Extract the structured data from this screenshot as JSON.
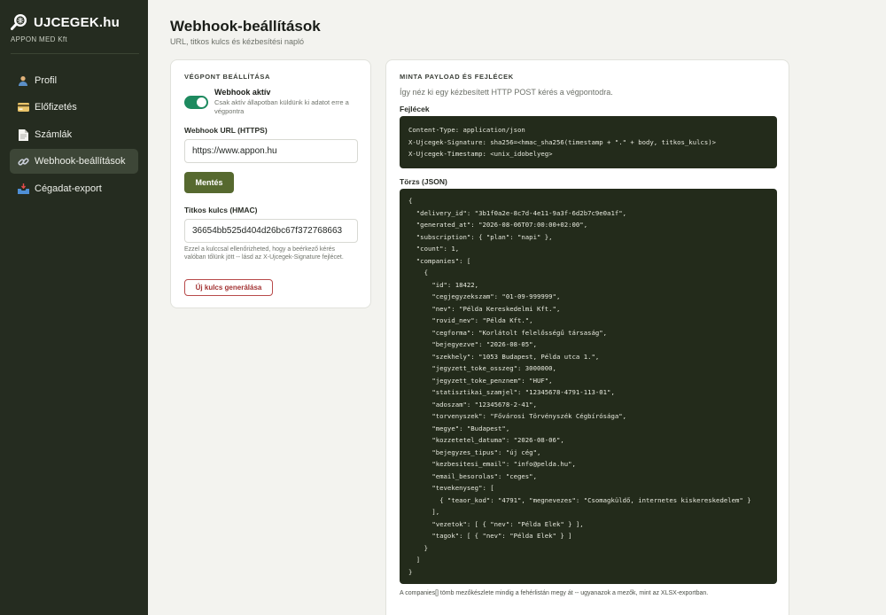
{
  "brand": {
    "name": "UJCEGEK.hu",
    "company": "APPON MED Kft"
  },
  "nav": [
    {
      "label": "Profil",
      "icon": "user-icon"
    },
    {
      "label": "Előfizetés",
      "icon": "credit-card-icon"
    },
    {
      "label": "Számlák",
      "icon": "document-icon"
    },
    {
      "label": "Webhook-beállítások",
      "icon": "link-icon",
      "active": true
    },
    {
      "label": "Cégadat-export",
      "icon": "inbox-tray-icon"
    }
  ],
  "page": {
    "title": "Webhook-beállítások",
    "subtitle": "URL, titkos kulcs és kézbesítési napló"
  },
  "endpoint": {
    "section_title": "VÉGPONT BEÁLLÍTÁSA",
    "toggle_title": "Webhook aktív",
    "toggle_desc": "Csak aktív állapotban küldünk ki adatot erre a végpontra",
    "toggle_on": true,
    "url_label": "Webhook URL (HTTPS)",
    "url_value": "https://www.appon.hu",
    "save_label": "Mentés",
    "secret_label": "Titkos kulcs (HMAC)",
    "secret_value": "36654bb525d404d26bc67f372768663",
    "secret_hint": "Ezzel a kulccsal ellenőrizheted, hogy a beérkező kérés valóban tőlünk jött -- lásd az X-Ujcegek-Signature fejlécet.",
    "generate_label": "Új kulcs generálása"
  },
  "payload": {
    "section_title": "MINTA PAYLOAD ÉS FEJLÉCEK",
    "description": "Így néz ki egy kézbesített HTTP POST kérés a végpontodra.",
    "headers_label": "Fejlécek",
    "headers_code": "Content-Type: application/json\nX-Ujcegek-Signature: sha256=<hmac_sha256(timestamp + \".\" + body, titkos_kulcs)>\nX-Ujcegek-Timestamp: <unix_idobelyeg>",
    "body_label": "Törzs (JSON)",
    "body_code": "{\n  \"delivery_id\": \"3b1f0a2e-8c7d-4e11-9a3f-6d2b7c9e0a1f\",\n  \"generated_at\": \"2026-08-06T07:00:00+02:00\",\n  \"subscription\": { \"plan\": \"napi\" },\n  \"count\": 1,\n  \"companies\": [\n    {\n      \"id\": 18422,\n      \"cegjegyzekszam\": \"01-09-999999\",\n      \"nev\": \"Példa Kereskedelmi Kft.\",\n      \"rovid_nev\": \"Példa Kft.\",\n      \"cegforma\": \"Korlátolt felelősségű társaság\",\n      \"bejegyezve\": \"2026-08-05\",\n      \"szekhely\": \"1053 Budapest, Példa utca 1.\",\n      \"jegyzett_toke_osszeg\": 3000000,\n      \"jegyzett_toke_penznem\": \"HUF\",\n      \"statisztikai_szamjel\": \"12345678-4791-113-01\",\n      \"adoszam\": \"12345678-2-41\",\n      \"torvenyszek\": \"Fővárosi Törvényszék Cégbírósága\",\n      \"megye\": \"Budapest\",\n      \"kozzetetel_datuma\": \"2026-08-06\",\n      \"bejegyzes_tipus\": \"új cég\",\n      \"kezbesitesi_email\": \"info@pelda.hu\",\n      \"email_besorolas\": \"ceges\",\n      \"tevekenyseg\": [\n        { \"teaor_kod\": \"4791\", \"megnevezes\": \"Csomagküldő, internetes kiskereskedelem\" }\n      ],\n      \"vezetok\": [ { \"nev\": \"Példa Elek\" } ],\n      \"tagok\": [ { \"nev\": \"Példa Elek\" } ]\n    }\n  ]\n}",
    "footnote": "A companies[] tömb mezőkészlete mindig a fehérlistán megy át -- ugyanazok a mezők, mint az XLSX-exportban."
  },
  "colors": {
    "sidebar": "#252c20",
    "accent_green": "#56692f",
    "toggle_on": "#1e8a5f",
    "danger": "#a33434"
  }
}
